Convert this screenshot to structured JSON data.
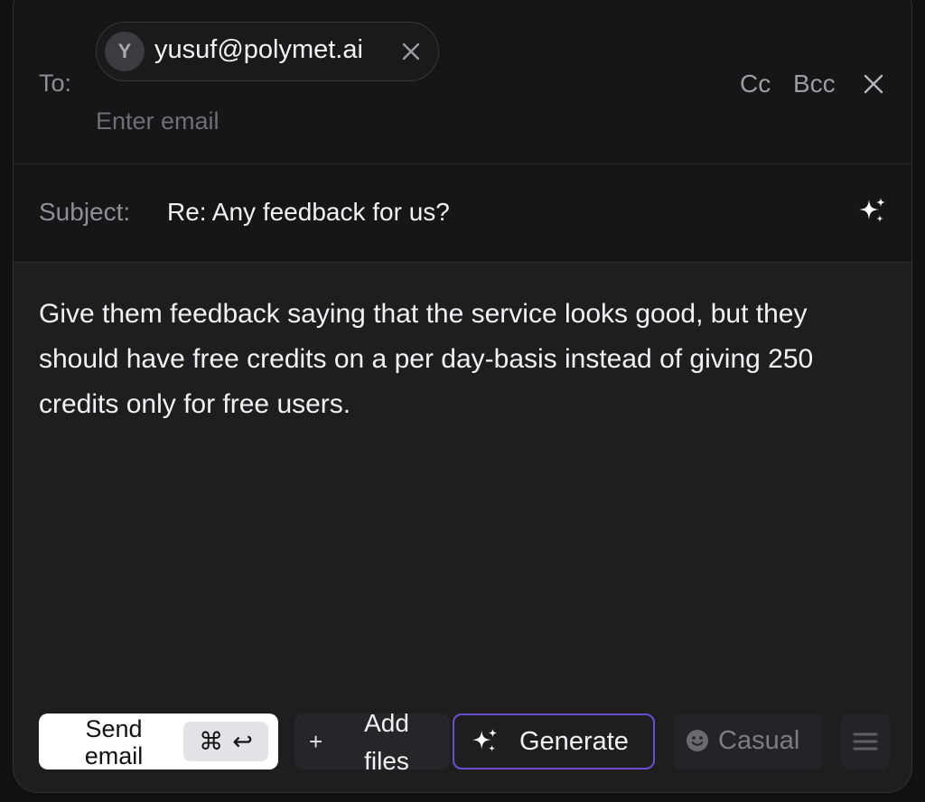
{
  "header": {
    "to_label": "To:",
    "recipient": {
      "avatar_initial": "Y",
      "email": "yusuf@polymet.ai"
    },
    "enter_email_placeholder": "Enter email",
    "cc_label": "Cc",
    "bcc_label": "Bcc"
  },
  "subject": {
    "label": "Subject:",
    "value": "Re: Any feedback for us?"
  },
  "body": {
    "text": "Give them feedback saying that the service looks good, but they should have free credits on a per day-basis instead of giving 250 credits only for free users."
  },
  "toolbar": {
    "send_label": "Send email",
    "send_shortcut_cmd": "⌘",
    "send_shortcut_enter": "↩",
    "add_plus": "+",
    "add_files_label": "Add files",
    "generate_label": "Generate",
    "tone_label": "Casual"
  },
  "colors": {
    "accent_border": "#6b4fd1",
    "background": "#1e1e1f",
    "header_background": "#161617"
  },
  "icons": {
    "chip_close": "close-icon",
    "header_close": "close-icon",
    "subject_sparkle": "sparkle-icon",
    "generate_sparkle": "sparkle-icon",
    "tone": "smiley-icon",
    "menu": "menu-lines-icon"
  }
}
